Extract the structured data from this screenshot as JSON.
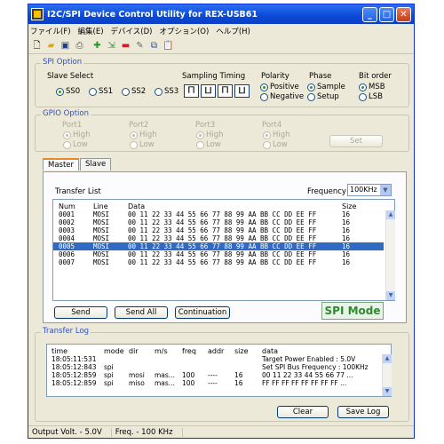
{
  "window": {
    "title": "I2C/SPI Device Control Utility for REX-USB61"
  },
  "menu": [
    "ファイル(F)",
    "編集(E)",
    "デバイス(D)",
    "オプション(O)",
    "ヘルプ(H)"
  ],
  "toolbar_icons": [
    "new-icon",
    "open-icon",
    "save-icon",
    "print-icon",
    "add-icon",
    "insert-icon",
    "remove-icon",
    "edit-icon",
    "copy-icon",
    "paste-icon"
  ],
  "spi_option": {
    "label": "SPI Option",
    "slave_select": {
      "label": "Slave Select",
      "options": [
        "SS0",
        "SS1",
        "SS2",
        "SS3"
      ],
      "selected": "SS0"
    },
    "sampling_timing": {
      "label": "Sampling Timing"
    },
    "polarity": {
      "label": "Polarity",
      "options": [
        "Positive",
        "Negative"
      ],
      "selected": "Positive"
    },
    "phase": {
      "label": "Phase",
      "options": [
        "Sample",
        "Setup"
      ],
      "selected": "Sample"
    },
    "bit_order": {
      "label": "Bit order",
      "options": [
        "MSB",
        "LSB"
      ],
      "selected": "MSB"
    }
  },
  "gpio_option": {
    "label": "GPIO Option",
    "ports": [
      {
        "name": "Port1",
        "high": "High",
        "low": "Low"
      },
      {
        "name": "Port2",
        "high": "High",
        "low": "Low"
      },
      {
        "name": "Port3",
        "high": "High",
        "low": "Low"
      },
      {
        "name": "Port4",
        "high": "High",
        "low": "Low"
      }
    ],
    "set_label": "Set"
  },
  "tabs": [
    "Master",
    "Slave"
  ],
  "transfer_list": {
    "label": "Transfer List",
    "frequency_label": "Frequency",
    "frequency_value": "100KHz",
    "columns": [
      "Num",
      "Line",
      "Data",
      "Size"
    ],
    "rows": [
      {
        "num": "0001",
        "line": "MOSI",
        "data": "00 11 22 33 44 55 66 77 88 99 AA BB CC DD EE FF",
        "size": "16"
      },
      {
        "num": "0002",
        "line": "MOSI",
        "data": "00 11 22 33 44 55 66 77 88 99 AA BB CC DD EE FF",
        "size": "16"
      },
      {
        "num": "0003",
        "line": "MOSI",
        "data": "00 11 22 33 44 55 66 77 88 99 AA BB CC DD EE FF",
        "size": "16"
      },
      {
        "num": "0004",
        "line": "MOSI",
        "data": "00 11 22 33 44 55 66 77 88 99 AA BB CC DD EE FF",
        "size": "16"
      },
      {
        "num": "0005",
        "line": "MOSI",
        "data": "00 11 22 33 44 55 66 77 88 99 AA BB CC DD EE FF",
        "size": "16"
      },
      {
        "num": "0006",
        "line": "MOSI",
        "data": "00 11 22 33 44 55 66 77 88 99 AA BB CC DD EE FF",
        "size": "16"
      },
      {
        "num": "0007",
        "line": "MOSI",
        "data": "00 11 22 33 44 55 66 77 88 99 AA BB CC DD EE FF",
        "size": "16"
      }
    ],
    "selected_row": 4,
    "buttons": {
      "send": "Send",
      "send_all": "Send All",
      "continuation": "Continuation"
    },
    "mode_badge": "SPI Mode"
  },
  "transfer_log": {
    "label": "Transfer Log",
    "columns": [
      "time",
      "mode",
      "dir",
      "m/s",
      "freq",
      "addr",
      "size",
      "data"
    ],
    "rows": [
      {
        "time": "18:05:11:531",
        "mode": "",
        "dir": "",
        "ms": "",
        "freq": "",
        "addr": "",
        "size": "",
        "data": "Target Power Enabled : 5.0V"
      },
      {
        "time": "18:05:12:843",
        "mode": "spi",
        "dir": "",
        "ms": "",
        "freq": "",
        "addr": "",
        "size": "",
        "data": "Set SPI Bus Frequency : 100KHz"
      },
      {
        "time": "18:05:12:859",
        "mode": "spi",
        "dir": "mosi",
        "ms": "mas...",
        "freq": "100",
        "addr": "----",
        "size": "16",
        "data": "00 11 22 33 44 55 66 77 ..."
      },
      {
        "time": "18:05:12:859",
        "mode": "spi",
        "dir": "miso",
        "ms": "mas...",
        "freq": "100",
        "addr": "----",
        "size": "16",
        "data": "FF FF FF FF FF FF FF FF ..."
      }
    ],
    "buttons": {
      "clear": "Clear",
      "save_log": "Save Log"
    }
  },
  "status": {
    "output_volt": "Output Volt. - 5.0V",
    "freq": "Freq. - 100 KHz"
  },
  "colors": {
    "title_bar": "#0a4ad6",
    "selection": "#316ac5",
    "mode_badge": "#2f8a2f"
  }
}
